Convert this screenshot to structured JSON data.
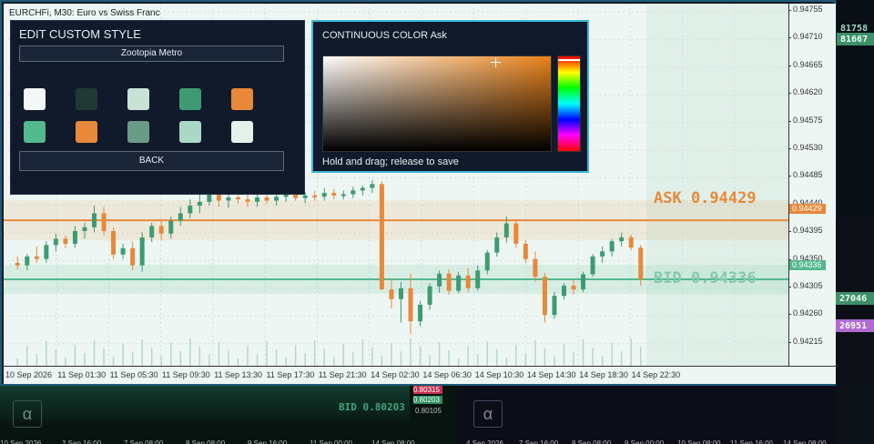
{
  "chart": {
    "title": "EURCHFi, M30:  Euro vs Swiss Franc",
    "price_ticks": [
      "0.94755",
      "0.94710",
      "0.94665",
      "0.94620",
      "0.94575",
      "0.94530",
      "0.94485",
      "0.94440",
      "0.94395",
      "0.94350",
      "0.94305",
      "0.94260",
      "0.94215"
    ],
    "time_ticks": [
      "10 Sep 2026",
      "11 Sep 01:30",
      "11 Sep 05:30",
      "11 Sep 09:30",
      "11 Sep 13:30",
      "11 Sep 17:30",
      "11 Sep 21:30",
      "14 Sep 02:30",
      "14 Sep 06:30",
      "14 Sep 10:30",
      "14 Sep 14:30",
      "14 Sep 18:30",
      "14 Sep 22:30"
    ],
    "ask_label": "ASK 0.94429",
    "bid_label": "BID 0.94336",
    "ask_tag": "0.94429",
    "bid_tag": "0.94336",
    "colors": {
      "ask": "#e8883a",
      "bid": "#52b88d",
      "bull": "#3f9a72",
      "bear": "#e8883a"
    }
  },
  "chart_data": {
    "type": "candlestick",
    "ask": 0.94429,
    "bid": 0.94336,
    "ylim": [
      0.942,
      0.9477
    ],
    "candles": [
      [
        0.94362,
        0.94372,
        0.94352,
        0.94358
      ],
      [
        0.94358,
        0.94376,
        0.9435,
        0.94372
      ],
      [
        0.94372,
        0.94388,
        0.94362,
        0.94368
      ],
      [
        0.94368,
        0.94396,
        0.94362,
        0.9439
      ],
      [
        0.9439,
        0.94408,
        0.9438,
        0.944
      ],
      [
        0.944,
        0.94405,
        0.94385,
        0.94392
      ],
      [
        0.94392,
        0.9442,
        0.94386,
        0.94412
      ],
      [
        0.94412,
        0.94425,
        0.944,
        0.94418
      ],
      [
        0.94418,
        0.94452,
        0.9441,
        0.9444
      ],
      [
        0.9444,
        0.9445,
        0.94405,
        0.94412
      ],
      [
        0.94412,
        0.94418,
        0.94368,
        0.94375
      ],
      [
        0.94375,
        0.94392,
        0.94368,
        0.94385
      ],
      [
        0.94385,
        0.94395,
        0.9435,
        0.94358
      ],
      [
        0.94358,
        0.9441,
        0.94348,
        0.94402
      ],
      [
        0.94402,
        0.94425,
        0.94395,
        0.9442
      ],
      [
        0.9442,
        0.9443,
        0.94398,
        0.94408
      ],
      [
        0.94408,
        0.94435,
        0.944,
        0.94428
      ],
      [
        0.94428,
        0.9445,
        0.9442,
        0.9444
      ],
      [
        0.9444,
        0.94462,
        0.94432,
        0.94452
      ],
      [
        0.94452,
        0.9447,
        0.9444,
        0.94458
      ],
      [
        0.94458,
        0.9448,
        0.94452,
        0.9447
      ],
      [
        0.9447,
        0.94478,
        0.9445,
        0.9446
      ],
      [
        0.9446,
        0.94472,
        0.94448,
        0.94465
      ],
      [
        0.94465,
        0.94474,
        0.94455,
        0.94462
      ],
      [
        0.94462,
        0.9447,
        0.9445,
        0.94458
      ],
      [
        0.94458,
        0.9447,
        0.9445,
        0.94465
      ],
      [
        0.94465,
        0.94472,
        0.94455,
        0.9446
      ],
      [
        0.9446,
        0.9447,
        0.94452,
        0.94466
      ],
      [
        0.94466,
        0.94478,
        0.94458,
        0.9447
      ],
      [
        0.9447,
        0.94476,
        0.9446,
        0.94464
      ],
      [
        0.94464,
        0.94474,
        0.94456,
        0.94468
      ],
      [
        0.94468,
        0.94475,
        0.9446,
        0.94466
      ],
      [
        0.94466,
        0.9448,
        0.9446,
        0.94472
      ],
      [
        0.94472,
        0.94478,
        0.94462,
        0.94468
      ],
      [
        0.94468,
        0.94476,
        0.94462,
        0.9447
      ],
      [
        0.9447,
        0.94482,
        0.94464,
        0.94476
      ],
      [
        0.94476,
        0.94484,
        0.94468,
        0.9448
      ],
      [
        0.9448,
        0.94492,
        0.94472,
        0.94486
      ],
      [
        0.94486,
        0.9449,
        0.9433,
        0.9432
      ],
      [
        0.9432,
        0.94338,
        0.9429,
        0.94305
      ],
      [
        0.94305,
        0.94332,
        0.94268,
        0.94322
      ],
      [
        0.94322,
        0.94345,
        0.9425,
        0.9427
      ],
      [
        0.9427,
        0.94302,
        0.94262,
        0.94296
      ],
      [
        0.94296,
        0.9433,
        0.94288,
        0.94325
      ],
      [
        0.94325,
        0.9435,
        0.94315,
        0.94345
      ],
      [
        0.94345,
        0.94352,
        0.94312,
        0.94318
      ],
      [
        0.94318,
        0.94348,
        0.94314,
        0.94342
      ],
      [
        0.94342,
        0.94354,
        0.94316,
        0.94322
      ],
      [
        0.94322,
        0.94358,
        0.94318,
        0.9435
      ],
      [
        0.9435,
        0.94382,
        0.94344,
        0.94378
      ],
      [
        0.94378,
        0.9441,
        0.94372,
        0.94402
      ],
      [
        0.94402,
        0.94435,
        0.94394,
        0.94424
      ],
      [
        0.94424,
        0.94428,
        0.94386,
        0.94392
      ],
      [
        0.94392,
        0.94398,
        0.94362,
        0.94368
      ],
      [
        0.94368,
        0.9438,
        0.94332,
        0.9434
      ],
      [
        0.9434,
        0.94346,
        0.94268,
        0.9428
      ],
      [
        0.9428,
        0.94316,
        0.94274,
        0.9431
      ],
      [
        0.9431,
        0.9433,
        0.94304,
        0.94326
      ],
      [
        0.94326,
        0.94336,
        0.94312,
        0.9432
      ],
      [
        0.9432,
        0.94348,
        0.94316,
        0.94344
      ],
      [
        0.94344,
        0.94376,
        0.9434,
        0.94372
      ],
      [
        0.94372,
        0.94388,
        0.94362,
        0.9438
      ],
      [
        0.9438,
        0.944,
        0.94372,
        0.94396
      ],
      [
        0.94396,
        0.9441,
        0.94388,
        0.94402
      ],
      [
        0.94402,
        0.94406,
        0.94382,
        0.94386
      ],
      [
        0.94386,
        0.9439,
        0.94326,
        0.94336
      ]
    ]
  },
  "panel_style": {
    "title": "EDIT CUSTOM STYLE",
    "theme_button": "Zootopia Metro",
    "back_button": "BACK",
    "swatches": [
      "#f3f7f5",
      "#203a33",
      "#c9e2d7",
      "#3f9a72",
      "#e8883a",
      "#52b88d",
      "#e8883a",
      "#6a9a88",
      "#a9d8c4",
      "#e2f2ea"
    ]
  },
  "panel_color": {
    "title": "CONTINUOUS COLOR  Ask",
    "base_color": "#e8821a",
    "hint": "Hold and drag; release to save"
  },
  "background": {
    "right_chips": [
      "81758",
      "81667",
      "27046",
      "26951"
    ],
    "bottom_left": {
      "bid_label": "BID 0.80203",
      "tags": [
        "0.80315",
        "0.80203",
        "0.80105"
      ]
    },
    "bottom_right_alpha": "α",
    "bottom_left_alpha": "α",
    "bottom_left_dates": [
      "10 Sep 2026",
      "2 Sep 16:00",
      "7 Sep 08:00",
      "8 Sep 08:00",
      "9 Sep 16:00",
      "11 Sep 00:00",
      "14 Sep 08:00"
    ],
    "bottom_right_dates": [
      "4 Sep 2026",
      "7 Sep 16:00",
      "8 Sep 08:00",
      "9 Sep 00:00",
      "10 Sep 08:00",
      "11 Sep 16:00",
      "14 Sep 08:00"
    ]
  }
}
